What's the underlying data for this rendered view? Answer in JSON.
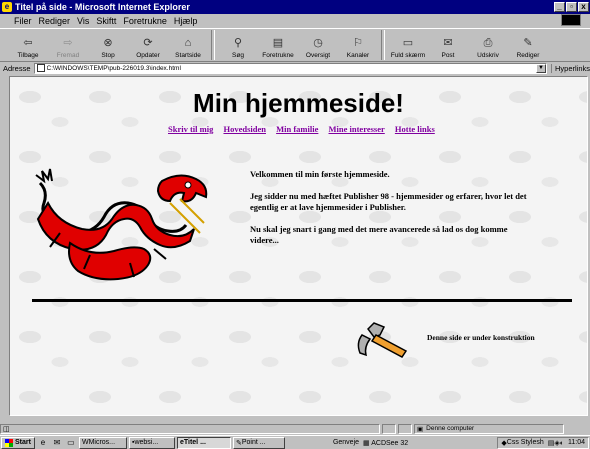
{
  "window": {
    "title": "Titel på side - Microsoft Internet Explorer",
    "min_glyph": "_",
    "max_glyph": "▫",
    "close_glyph": "x"
  },
  "menu": [
    "Filer",
    "Rediger",
    "Vis",
    "Skiftt",
    "Foretrukne",
    "Hjælp"
  ],
  "toolbar": [
    {
      "label": "Tilbage",
      "icon": "back-arrow-icon",
      "glyph": "⇦",
      "enabled": true
    },
    {
      "label": "Fremad",
      "icon": "forward-arrow-icon",
      "glyph": "⇨",
      "enabled": false
    },
    {
      "label": "Stop",
      "icon": "stop-icon",
      "glyph": "⊗",
      "enabled": true
    },
    {
      "label": "Opdater",
      "icon": "refresh-icon",
      "glyph": "⟳",
      "enabled": true
    },
    {
      "label": "Startside",
      "icon": "home-icon",
      "glyph": "⌂",
      "enabled": true
    },
    {
      "label": "Søg",
      "icon": "search-icon",
      "glyph": "⚲",
      "enabled": true
    },
    {
      "label": "Foretrukne",
      "icon": "favorites-icon",
      "glyph": "▤",
      "enabled": true
    },
    {
      "label": "Oversigt",
      "icon": "history-icon",
      "glyph": "◷",
      "enabled": true
    },
    {
      "label": "Kanaler",
      "icon": "channels-icon",
      "glyph": "⚐",
      "enabled": true
    },
    {
      "label": "Fuld skærm",
      "icon": "fullscreen-icon",
      "glyph": "▭",
      "enabled": true
    },
    {
      "label": "Post",
      "icon": "mail-icon",
      "glyph": "✉",
      "enabled": true
    },
    {
      "label": "Udskriv",
      "icon": "print-icon",
      "glyph": "⎙",
      "enabled": true
    },
    {
      "label": "Rediger",
      "icon": "edit-icon",
      "glyph": "✎",
      "enabled": true
    }
  ],
  "address": {
    "label": "Adresse",
    "value": "C:\\WINDOWS\\TEMP\\pub-226019.3\\index.html",
    "links_label": "Hyperlinks"
  },
  "page": {
    "title": "Min hjemmeside!",
    "nav": [
      "Skriv til mig",
      "Hovedsiden",
      "Min familie",
      "Mine interesser",
      "Hotte links"
    ],
    "paragraphs": [
      "Velkommen til min første hjemmeside.",
      "Jeg sidder nu med hæftet Publisher 98 - hjemmesider og erfarer, hvor let det egentlig er at lave hjemmesider i Publisher.",
      "Nu skal jeg snart i gang med det mere avancerede så lad os dog komme videre..."
    ],
    "construction_text": "Denne side er under konstruktion"
  },
  "status": {
    "zone": "Denne computer"
  },
  "taskbar": {
    "start_label": "Start",
    "tasks": [
      "Micros...",
      "websi...",
      "Titel ...",
      "Point ..."
    ],
    "active_task_index": 2,
    "genveje": "Genveje",
    "acdsee": "ACDSee 32",
    "stylesheet": "Css Stylesh",
    "clock": "11:04"
  },
  "colors": {
    "link": "#8000a0",
    "titlebar": "#000080",
    "dragon_red": "#e00000"
  }
}
